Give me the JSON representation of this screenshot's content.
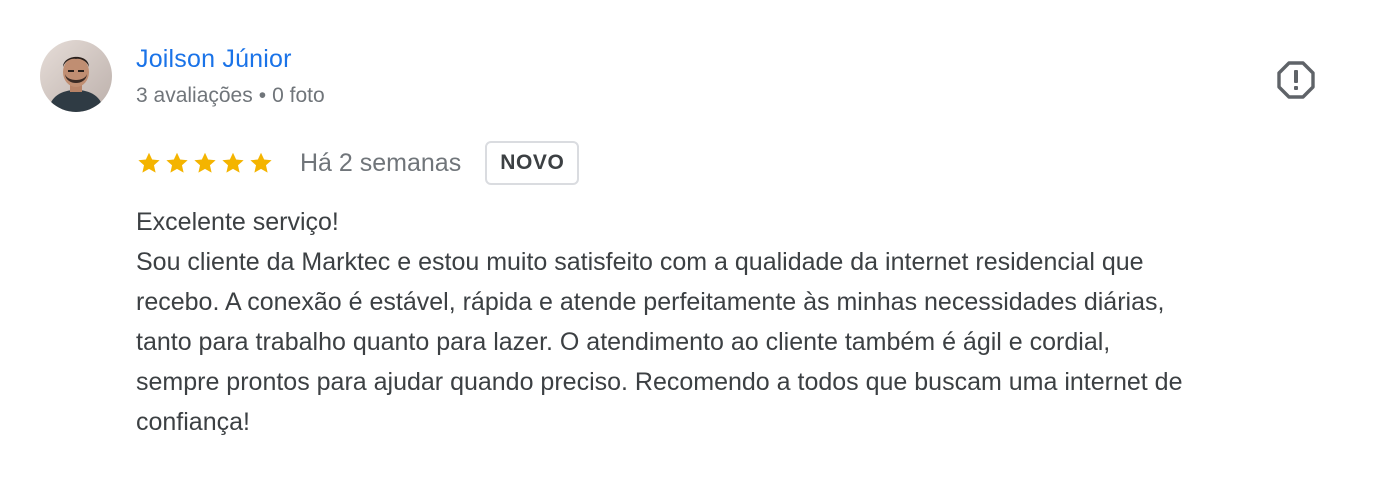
{
  "author": {
    "name": "Joilson Júnior",
    "reviews_count": "3 avaliações",
    "separator": "•",
    "photos_count": "0 foto",
    "avatar_icon": "user-avatar-photo"
  },
  "report_icon": "report-flag-octagon-icon",
  "rating": {
    "stars": 5,
    "max": 5,
    "star_color": "#f4b400"
  },
  "review": {
    "date": "Há 2 semanas",
    "badge": "NOVO",
    "text_lines": [
      "Excelente serviço!",
      "Sou cliente da Marktec e estou muito satisfeito com a qualidade da internet residencial que",
      "recebo. A conexão é estável, rápida e atende perfeitamente às minhas necessidades diárias,",
      "tanto para trabalho quanto para lazer. O atendimento ao cliente também é ágil e cordial,",
      "sempre prontos para ajudar quando preciso. Recomendo a todos que buscam uma internet de",
      "confiança!"
    ]
  },
  "colors": {
    "author_link": "#1a73e8",
    "muted_text": "#70757a",
    "body_text": "#3c4043",
    "badge_border": "#dadce0"
  }
}
